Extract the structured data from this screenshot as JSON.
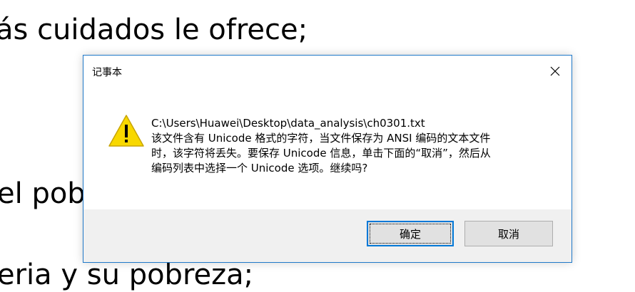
{
  "background": {
    "lines": [
      "ás cuidados le ofrece;",
      "el pobre",
      "eria y su pobreza;"
    ]
  },
  "dialog": {
    "title": "记事本",
    "icon": "warning-triangle-icon",
    "message_lines": [
      "C:\\Users\\Huawei\\Desktop\\data_analysis\\ch0301.txt",
      "该文件含有 Unicode 格式的字符，当文件保存为 ANSI 编码的文本文件",
      "时，该字符将丢失。要保存 Unicode 信息，单击下面的“取消”，然后从",
      "编码列表中选择一个 Unicode 选项。继续吗?"
    ],
    "buttons": {
      "ok_label": "确定",
      "cancel_label": "取消"
    }
  },
  "colors": {
    "accent": "#0078d7",
    "dialog_border": "#1f78c8",
    "footer_bg": "#f0f0f0",
    "button_bg": "#e1e1e1",
    "warning_yellow": "#f8d800"
  }
}
